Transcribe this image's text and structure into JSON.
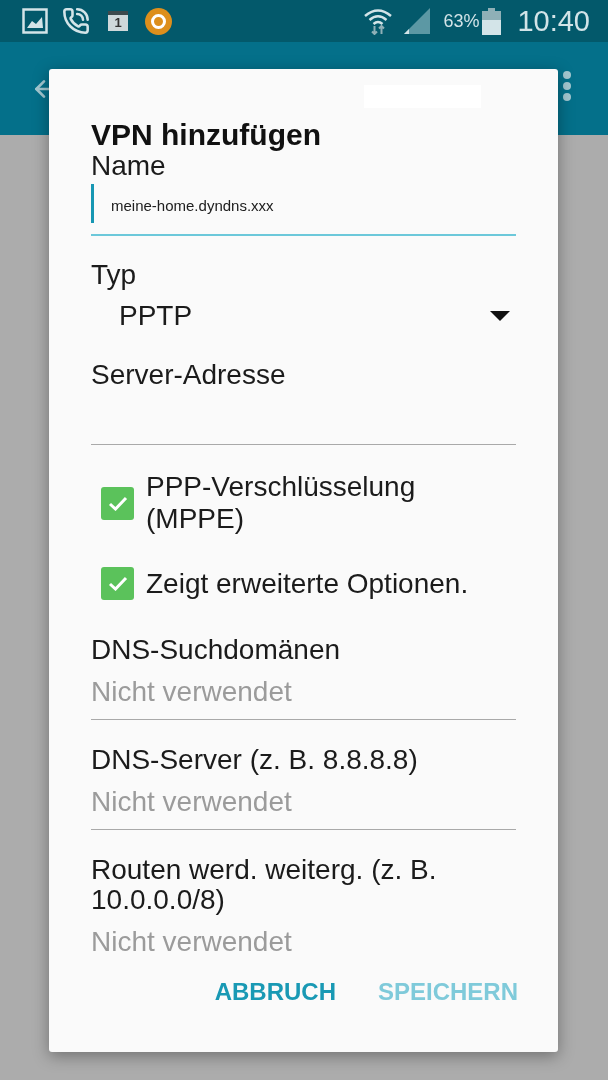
{
  "status_bar": {
    "calendar_day": "1",
    "battery": "63%",
    "time": "10:40"
  },
  "dialog": {
    "title": "VPN hinzufügen",
    "fields": [
      {
        "kind": "text",
        "label": "Name",
        "value": "meine-home.dyndns.xxx",
        "focused": true
      },
      {
        "kind": "dropdown",
        "label": "Typ",
        "value": "PPTP"
      },
      {
        "kind": "text",
        "label": "Server-Adresse",
        "focused": false
      },
      {
        "kind": "checkbox",
        "label": "PPP-Verschlüsselung (MPPE)",
        "checked": true
      },
      {
        "kind": "checkbox",
        "label": "Zeigt erweiterte Optionen.",
        "checked": true
      },
      {
        "kind": "text",
        "label": "DNS-Suchdomänen",
        "placeholder": "Nicht verwendet",
        "focused": false
      },
      {
        "kind": "text",
        "label": "DNS-Server (z. B. 8.8.8.8)",
        "placeholder": "Nicht verwendet",
        "focused": false
      },
      {
        "kind": "text",
        "label": "Routen werd. weiterg. (z. B. 10.0.0.0/8)",
        "placeholder": "Nicht verwendet",
        "focused": false
      }
    ],
    "buttons": [
      {
        "label": "ABBRUCH",
        "disabled": false
      },
      {
        "label": "SPEICHERN",
        "disabled": true
      }
    ]
  }
}
